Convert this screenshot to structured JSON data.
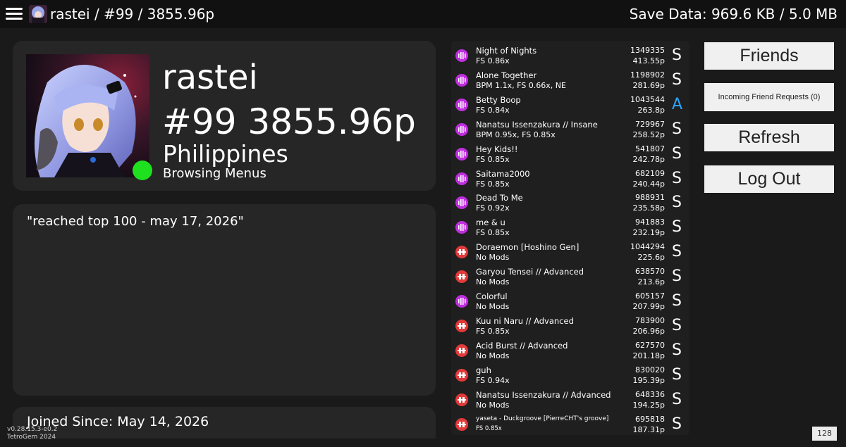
{
  "topbar": {
    "title": "rastei / #99 / 3855.96p",
    "save_data": "Save Data: 969.6 KB / 5.0 MB"
  },
  "profile": {
    "username": "rastei",
    "rank_pp": "#99 3855.96p",
    "country": "Philippines",
    "activity": "Browsing Menus",
    "status_color": "#1fe01f",
    "bio": "\"reached top 100 - may 17, 2026\"",
    "joined": "Joined Since: May 14, 2026"
  },
  "version": {
    "line1": "v0.28.15.3-e0.2",
    "line2": "TetroGem 2024"
  },
  "colors": {
    "mode_purple": "#c02ee0",
    "mode_red": "#e23a3a",
    "grade_s": "#ffffff",
    "grade_a": "#2ea6ff"
  },
  "scores": [
    {
      "title": "Night of Nights",
      "mods": "FS 0.86x",
      "score": "1349335",
      "pp": "413.55p",
      "grade": "S",
      "mode": "purple"
    },
    {
      "title": "Alone Together",
      "mods": "BPM 1.1x, FS 0.66x, NE",
      "score": "1198902",
      "pp": "281.69p",
      "grade": "S",
      "mode": "purple"
    },
    {
      "title": "Betty Boop",
      "mods": "FS 0.84x",
      "score": "1043544",
      "pp": "263.8p",
      "grade": "A",
      "mode": "purple"
    },
    {
      "title": "Nanatsu Issenzakura // Insane",
      "mods": "BPM 0.95x, FS 0.85x",
      "score": "729967",
      "pp": "258.52p",
      "grade": "S",
      "mode": "purple"
    },
    {
      "title": "Hey Kids!!",
      "mods": "FS 0.85x",
      "score": "541807",
      "pp": "242.78p",
      "grade": "S",
      "mode": "purple"
    },
    {
      "title": "Saitama2000",
      "mods": "FS 0.85x",
      "score": "682109",
      "pp": "240.44p",
      "grade": "S",
      "mode": "purple"
    },
    {
      "title": "Dead To Me",
      "mods": "FS 0.92x",
      "score": "988931",
      "pp": "235.58p",
      "grade": "S",
      "mode": "purple"
    },
    {
      "title": "me & u",
      "mods": "FS 0.85x",
      "score": "941883",
      "pp": "232.19p",
      "grade": "S",
      "mode": "purple"
    },
    {
      "title": "Doraemon [Hoshino Gen]",
      "mods": "No Mods",
      "score": "1044294",
      "pp": "225.6p",
      "grade": "S",
      "mode": "red"
    },
    {
      "title": "Garyou Tensei // Advanced",
      "mods": "No Mods",
      "score": "638570",
      "pp": "213.6p",
      "grade": "S",
      "mode": "red"
    },
    {
      "title": "Colorful",
      "mods": "No Mods",
      "score": "605157",
      "pp": "207.99p",
      "grade": "S",
      "mode": "purple"
    },
    {
      "title": "Kuu ni Naru // Advanced",
      "mods": "FS 0.85x",
      "score": "783900",
      "pp": "206.96p",
      "grade": "S",
      "mode": "red"
    },
    {
      "title": "Acid Burst // Advanced",
      "mods": "No Mods",
      "score": "627570",
      "pp": "201.18p",
      "grade": "S",
      "mode": "red"
    },
    {
      "title": "guh",
      "mods": "FS 0.94x",
      "score": "830020",
      "pp": "195.39p",
      "grade": "S",
      "mode": "red"
    },
    {
      "title": "Nanatsu Issenzakura // Advanced",
      "mods": "No Mods",
      "score": "648336",
      "pp": "194.25p",
      "grade": "S",
      "mode": "red"
    },
    {
      "title": "yaseta - Duckgroove [PierreCHT's groove]",
      "mods": "FS 0.85x",
      "score": "695818",
      "pp": "187.31p",
      "grade": "S",
      "mode": "red"
    }
  ],
  "buttons": {
    "friends": "Friends",
    "friend_requests": "Incoming Friend Requests (0)",
    "refresh": "Refresh",
    "logout": "Log Out"
  },
  "counter": "128"
}
